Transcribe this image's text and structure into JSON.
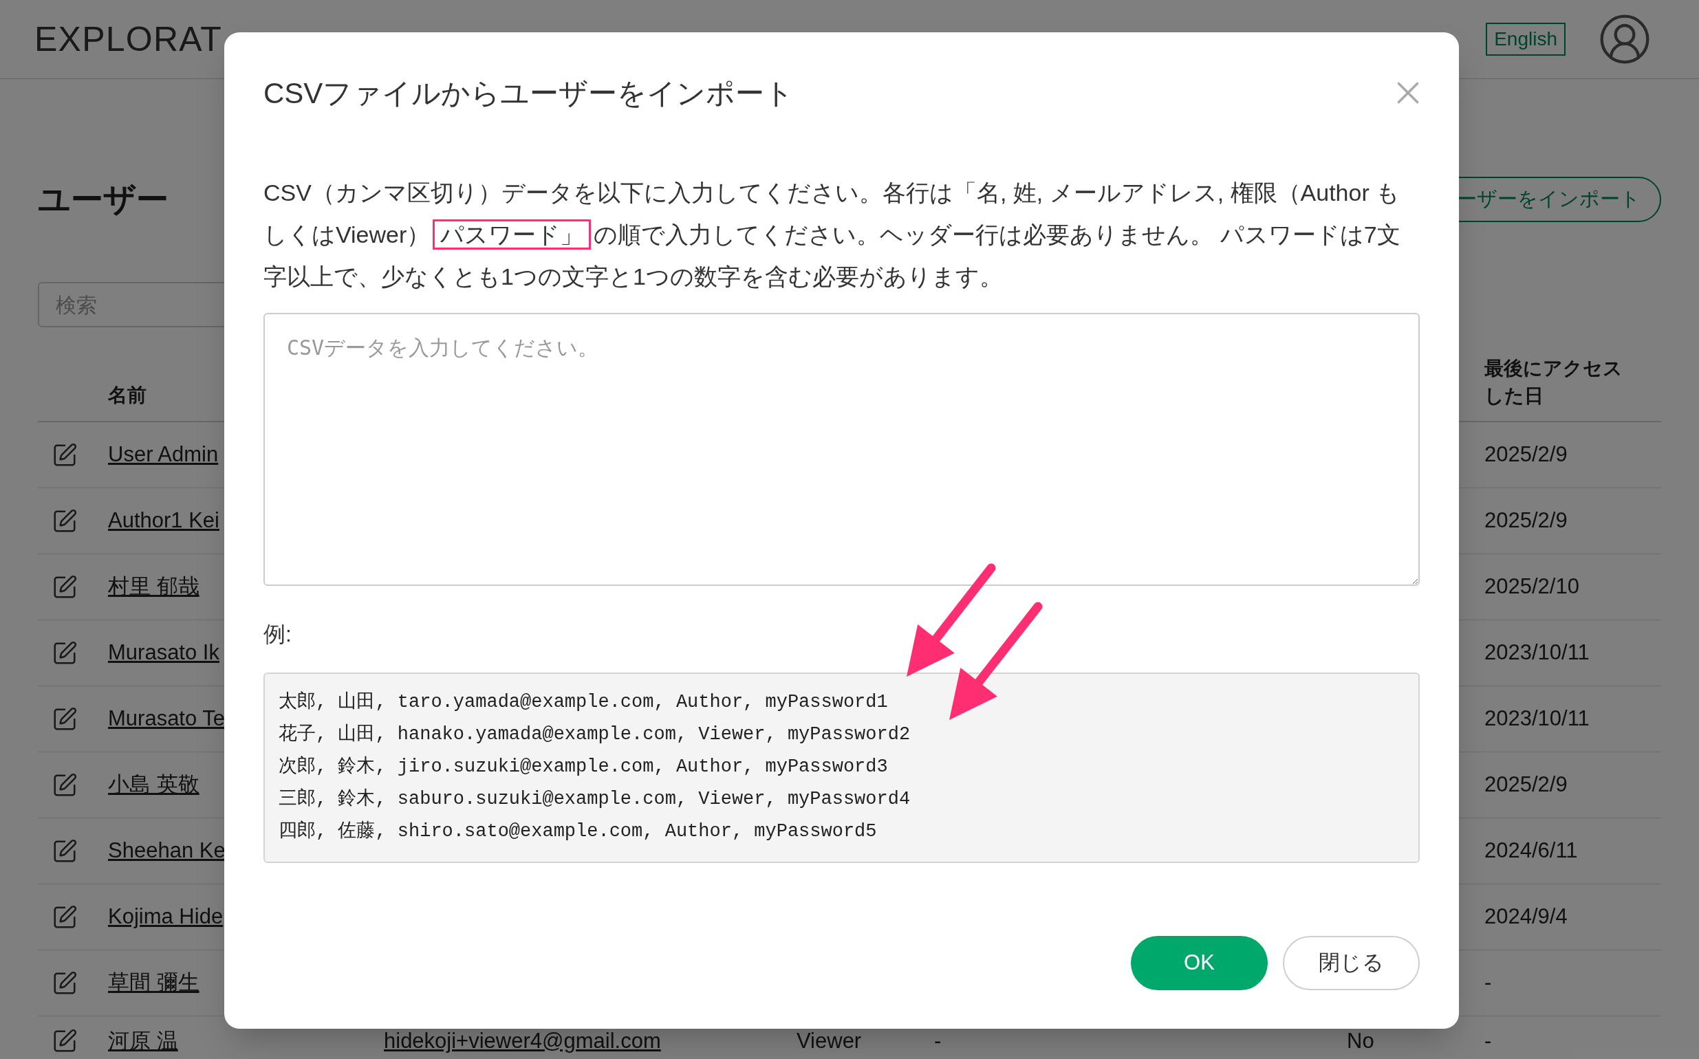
{
  "header": {
    "logo": "EXPLORAT",
    "language_button": "English"
  },
  "page": {
    "title": "ユーザー",
    "import_button": "ーザーをインポート",
    "search": {
      "placeholder": "検索"
    }
  },
  "table": {
    "columns": {
      "name": "名前",
      "last_access": "最後にアクセスした日"
    },
    "rows": [
      {
        "name": "User Admin",
        "last_access": "2025/2/9"
      },
      {
        "name": "Author1 Kei",
        "last_access": "2025/2/9"
      },
      {
        "name": "村里 郁哉",
        "last_access": "2025/2/10"
      },
      {
        "name": "Murasato Ik",
        "last_access": "2023/10/11"
      },
      {
        "name": "Murasato Te",
        "last_access": "2023/10/11"
      },
      {
        "name": "小島 英敬",
        "last_access": "2025/2/9"
      },
      {
        "name": "Sheehan Ke",
        "last_access": "2024/6/11"
      },
      {
        "name": "Kojima Hide",
        "last_access": "2024/9/4"
      },
      {
        "name": "草間 彌生",
        "last_access": "-"
      },
      {
        "name": "河原 温",
        "column_3": "hidekoji+viewer4@gmail.com",
        "column_4": "Viewer",
        "column_5": "-",
        "column_6": "No",
        "last_access": "-"
      }
    ]
  },
  "dialog": {
    "title": "CSVファイルからユーザーをインポート",
    "description": {
      "before": "CSV（カンマ区切り）データを以下に入力してください。各行は「名, 姓, メールアドレス, 権限（Author もしくはViewer）",
      "highlight": "パスワード」",
      "after": "の順で入力してください。ヘッダー行は必要ありません。 パスワードは7文字以上で、少なくとも1つの文字と1つの数字を含む必要があります。"
    },
    "csv_field": {
      "placeholder": "CSVデータを入力してください。"
    },
    "example_label": "例:",
    "example_lines": [
      "太郎, 山田, taro.yamada@example.com, Author, myPassword1",
      "花子, 山田, hanako.yamada@example.com, Viewer, myPassword2",
      "次郎, 鈴木, jiro.suzuki@example.com, Author, myPassword3",
      "三郎, 鈴木, saburo.suzuki@example.com, Viewer, myPassword4",
      "四郎, 佐藤, shiro.sato@example.com, Author, myPassword5"
    ],
    "buttons": [
      {
        "label": "OK",
        "kind": "primary"
      },
      {
        "label": "閉じる",
        "kind": "secondary"
      }
    ]
  }
}
